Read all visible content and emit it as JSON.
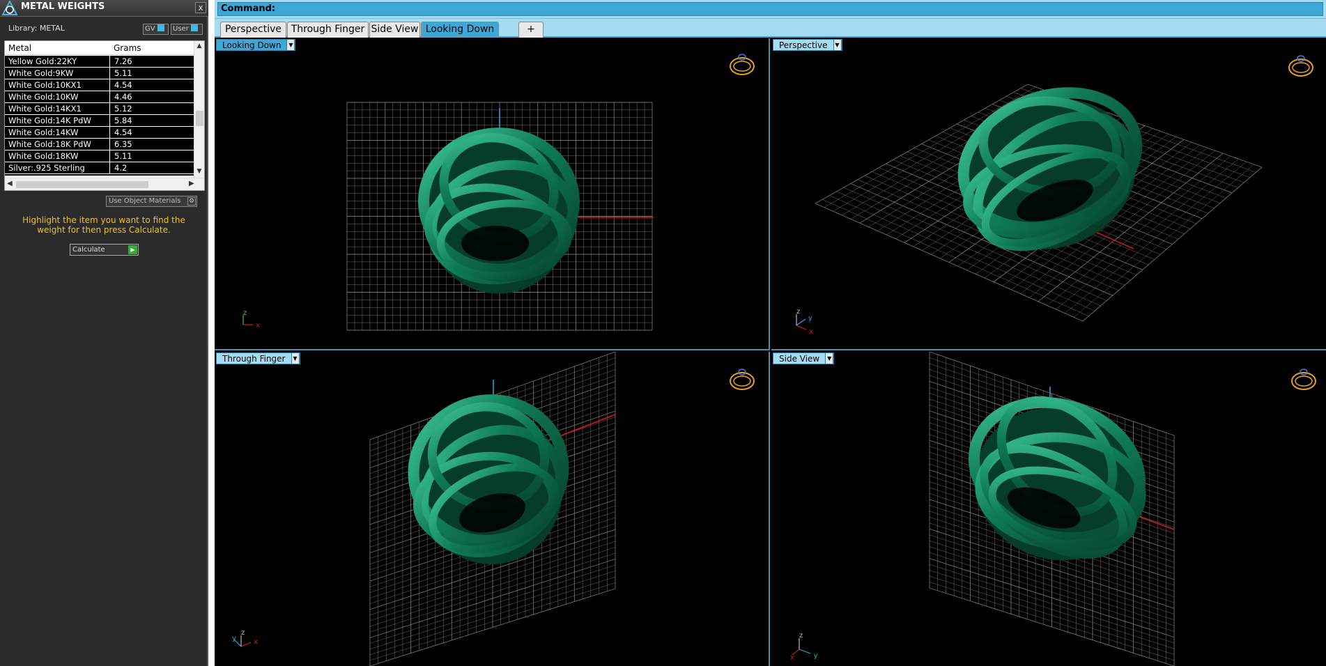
{
  "panel": {
    "title": "METAL WEIGHTS",
    "close_label": "x",
    "library_label": "Library: METAL",
    "gv_label": "GV",
    "user_label": "User",
    "table": {
      "col_metal": "Metal",
      "col_grams": "Grams",
      "rows": [
        {
          "metal": "Yellow Gold:22KY",
          "grams": "7.26"
        },
        {
          "metal": "White Gold:9KW",
          "grams": "5.11"
        },
        {
          "metal": "White Gold:10KX1",
          "grams": "4.54"
        },
        {
          "metal": "White Gold:10KW",
          "grams": "4.46"
        },
        {
          "metal": "White Gold:14KX1",
          "grams": "5.12"
        },
        {
          "metal": "White Gold:14K PdW",
          "grams": "5.84"
        },
        {
          "metal": "White Gold:14KW",
          "grams": "4.54"
        },
        {
          "metal": "White Gold:18K PdW",
          "grams": "6.35"
        },
        {
          "metal": "White Gold:18KW",
          "grams": "5.11"
        },
        {
          "metal": "Silver:.925 Sterling",
          "grams": "4.2"
        }
      ]
    },
    "use_materials_label": "Use Object Materials",
    "hint": "Highlight the item you want to find the weight for then press Calculate.",
    "calculate_label": "Calculate"
  },
  "command": {
    "label": "Command:"
  },
  "tabs": [
    {
      "label": "Perspective",
      "active": false
    },
    {
      "label": "Through Finger",
      "active": false
    },
    {
      "label": "Side View",
      "active": false
    },
    {
      "label": "Looking Down",
      "active": true
    }
  ],
  "tab_add": "+",
  "viewports": {
    "top_left": {
      "label": "Looking Down",
      "axes": [
        "z",
        "x"
      ]
    },
    "top_right": {
      "label": "Perspective",
      "axes": [
        "z",
        "y",
        "x"
      ]
    },
    "bottom_left": {
      "label": "Through Finger",
      "axes": [
        "y",
        "z",
        "x"
      ]
    },
    "bottom_right": {
      "label": "Side View",
      "axes": [
        "z",
        "y",
        "x"
      ]
    }
  },
  "colors": {
    "ring": "#0f7a55",
    "ring_highlight": "#3fc79a",
    "grid": "#8c8c8c",
    "accent": "#3fa7d6",
    "hint": "#f2c21d",
    "ring_icon": "#e8a020"
  },
  "icons": {
    "panel_logo": "app-logo-icon",
    "view_ring": "ring-view-icon",
    "dropdown": "chevron-down-icon"
  }
}
